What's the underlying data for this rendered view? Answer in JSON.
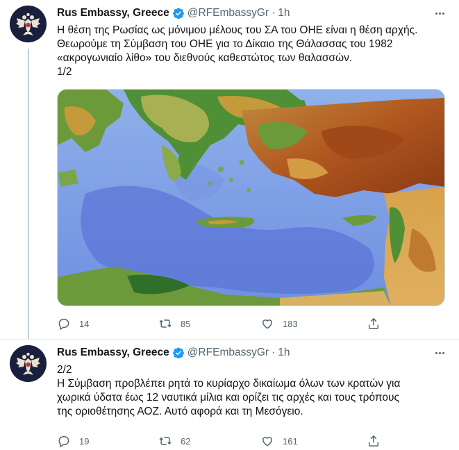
{
  "tweets": [
    {
      "display_name": "Rus Embassy, Greece",
      "handle": "@RFEmbassyGr",
      "separator": "·",
      "time": "1h",
      "text_lines": [
        "Η θέση της Ρωσίας ως μόνιμου μέλους του ΣΑ του ΟΗΕ είναι η θέση αρχής.",
        "Θεωρούμε τη Σύμβαση του ΟΗΕ για το Δίκαιο της Θάλασσας του 1982",
        "«ακρογωνιαίο λίθο» του διεθνούς καθεστώτος των θαλασσών.",
        "1/2"
      ],
      "replies": "14",
      "retweets": "85",
      "likes": "183"
    },
    {
      "display_name": "Rus Embassy, Greece",
      "handle": "@RFEmbassyGr",
      "separator": "·",
      "time": "1h",
      "text_lines": [
        "2/2",
        "Η Σύμβαση προβλέπει ρητά το κυρίαρχο δικαίωμα όλων των κρατών για",
        "χωρικά ύδατα έως 12 ναυτικά μίλια και ορίζει τις αρχές και τους τρόπους",
        "της οριοθέτησης ΑΟΖ. Αυτό αφορά και τη Μεσόγειο."
      ],
      "replies": "19",
      "retweets": "62",
      "likes": "161"
    }
  ],
  "icons": {
    "verified": "verified-badge-icon",
    "more": "more-dots-icon",
    "reply": "reply-icon",
    "retweet": "retweet-icon",
    "like": "heart-icon",
    "share": "share-icon"
  },
  "colors": {
    "verified": "#1d9bf0",
    "secondary_text": "#536471",
    "thread_line": "#c4cfd6",
    "avatar_bg": "#1a1f3d"
  }
}
